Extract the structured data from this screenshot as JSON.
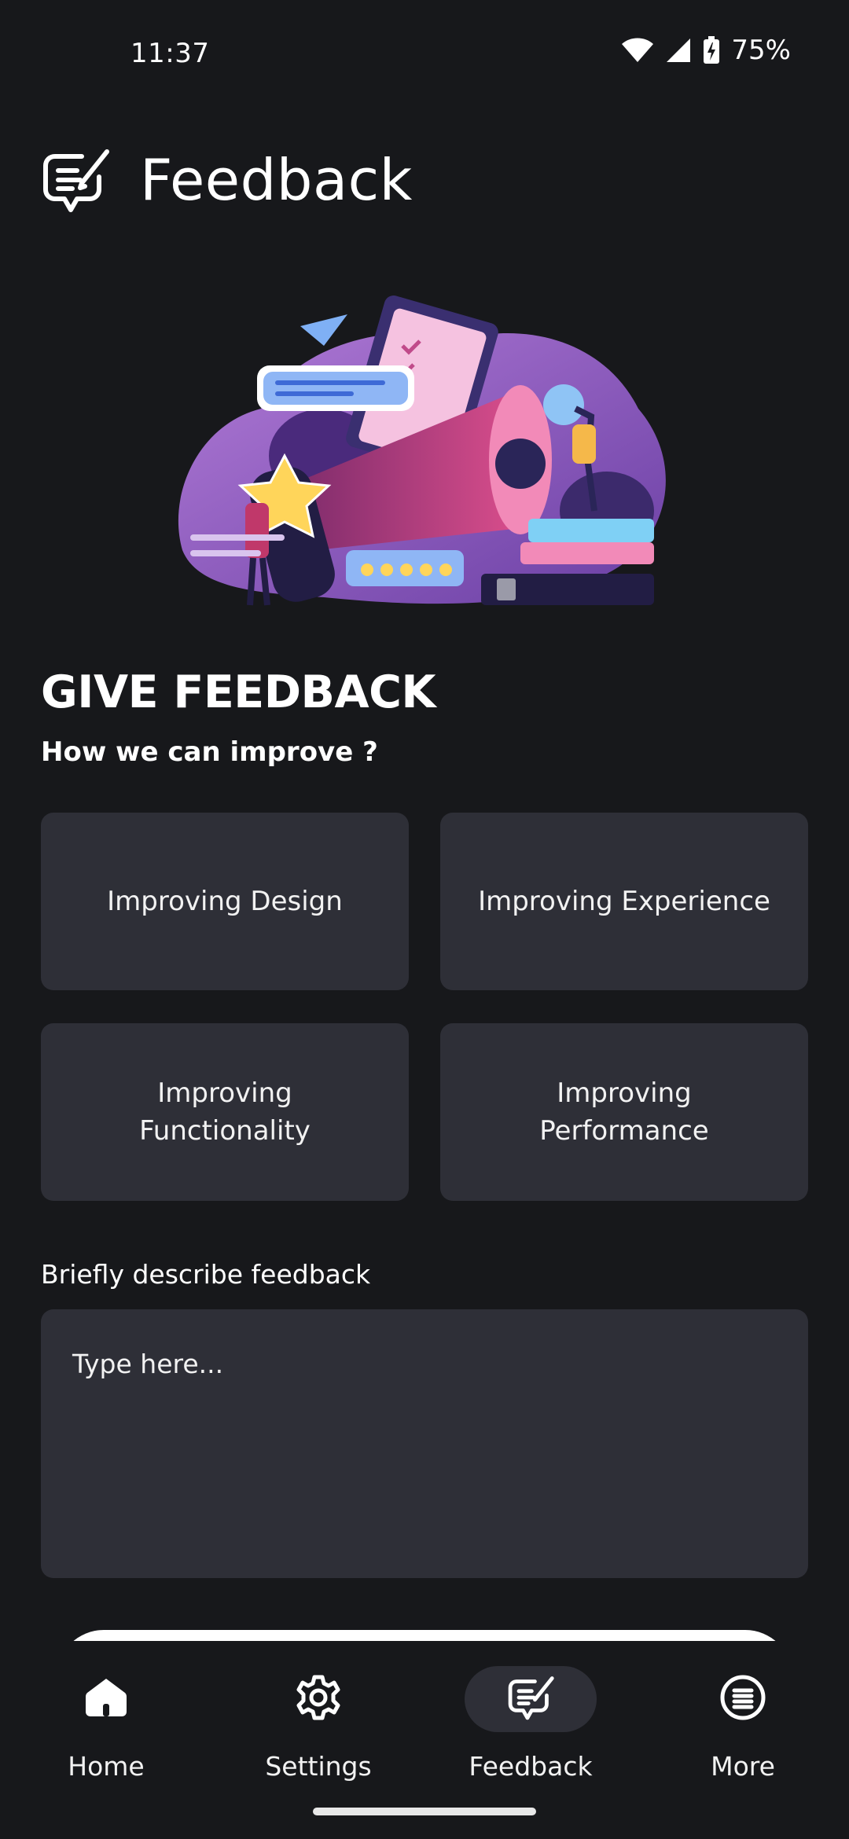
{
  "status_bar": {
    "time": "11:37",
    "battery": "75%",
    "icons": [
      "wifi-icon",
      "signal-icon",
      "battery-charging-icon"
    ]
  },
  "header": {
    "title": "Feedback",
    "icon": "feedback-edit-icon"
  },
  "section": {
    "title": "GIVE FEEDBACK",
    "subtitle": "How we can improve ?"
  },
  "options": [
    {
      "label": "Improving Design"
    },
    {
      "label": "Improving Experience"
    },
    {
      "label": "Improving Functionality"
    },
    {
      "label": "Improving Performance"
    }
  ],
  "description": {
    "label": "Briefly describe feedback",
    "placeholder": "Type here..."
  },
  "bottom_nav": {
    "items": [
      {
        "label": "Home",
        "icon": "home-icon",
        "active": false
      },
      {
        "label": "Settings",
        "icon": "gear-icon",
        "active": false
      },
      {
        "label": "Feedback",
        "icon": "feedback-edit-icon",
        "active": true
      },
      {
        "label": "More",
        "icon": "menu-circle-icon",
        "active": false
      }
    ]
  },
  "colors": {
    "background": "#17181b",
    "card": "#2e2f37",
    "text": "#ffffff"
  }
}
